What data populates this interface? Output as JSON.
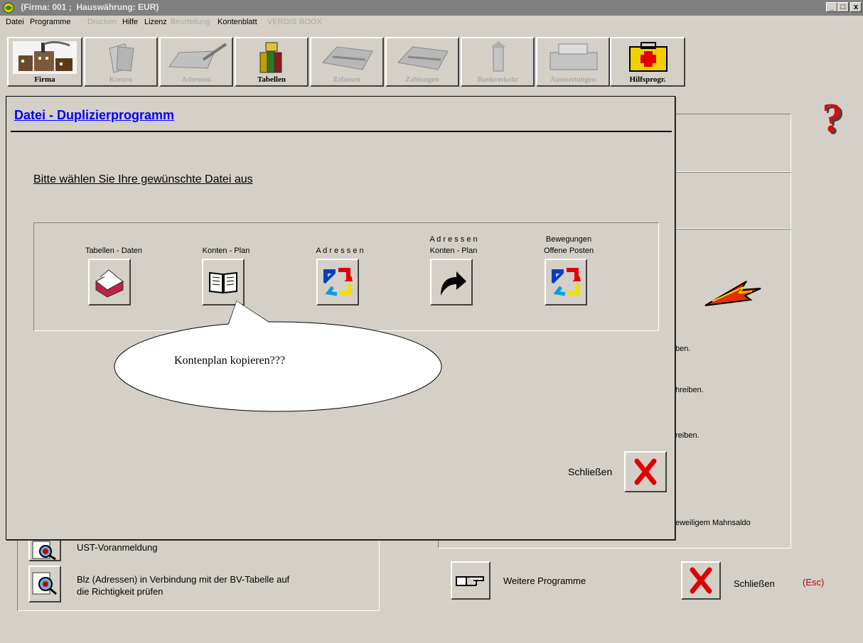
{
  "app": {
    "title": " (Firma: 001 ;  Hauswährung: EUR)",
    "window_buttons": [
      "_",
      "□",
      "x"
    ]
  },
  "menu": [
    {
      "label": "Datei",
      "enabled": true
    },
    {
      "label": "Programme",
      "enabled": true
    },
    {
      "label": "Drucken",
      "enabled": false
    },
    {
      "label": "Hilfe",
      "enabled": true
    },
    {
      "label": "Lizenz",
      "enabled": true
    },
    {
      "label": "Beurteilung",
      "enabled": false
    },
    {
      "label": "Kontenblatt",
      "enabled": true
    },
    {
      "label": "VERDIS",
      "enabled": false
    },
    {
      "label": "BOOX",
      "enabled": false
    }
  ],
  "toolbar": [
    {
      "label": "Firma",
      "enabled": true,
      "icon": "factory-icon"
    },
    {
      "label": "Konten",
      "enabled": false,
      "icon": "papers-icon"
    },
    {
      "label": "Adressen",
      "enabled": false,
      "icon": "pen-icon"
    },
    {
      "label": "Tabellen",
      "enabled": true,
      "icon": "books-icon"
    },
    {
      "label": "Erfassen",
      "enabled": false,
      "icon": "typewriter-icon"
    },
    {
      "label": "Zahlungen",
      "enabled": false,
      "icon": "typewriter-icon"
    },
    {
      "label": "Bankverkehr",
      "enabled": false,
      "icon": "bank-icon"
    },
    {
      "label": "Auswertungen",
      "enabled": false,
      "icon": "printer-icon"
    },
    {
      "label": "Hilfsprogr.",
      "enabled": true,
      "icon": "first-aid-kit-icon"
    }
  ],
  "dialog": {
    "title": "Datei - Duplizierprogramm",
    "prompt": "Bitte wählen Sie Ihre gewünschte Datei aus",
    "options": [
      {
        "label1": "",
        "label2": "Tabellen - Daten",
        "icon": "card-file-icon"
      },
      {
        "label1": "",
        "label2": "Konten  -  Plan",
        "icon": "open-book-icon"
      },
      {
        "label1": "",
        "label2": "A d r e s s e n",
        "icon": "sync-arrows-icon"
      },
      {
        "label1": "A d r e s s e n",
        "label2": "Konten  -  Plan",
        "icon": "curved-arrow-icon"
      },
      {
        "label1": "Bewegungen",
        "label2": "Offene Posten",
        "icon": "sync-arrows-icon"
      }
    ],
    "callout": "Kontenplan kopieren???",
    "close_label": "Schließen"
  },
  "background": {
    "partial_texts": [
      "ben.",
      "hreiben.",
      "reiben.",
      "eweiligem Mahnsaldo"
    ],
    "ust_label": "UST-Voranmeldung",
    "blz_line1": "Blz (Adressen) in Verbindung mit der BV-Tabelle auf",
    "blz_line2": "die Richtigkeit prüfen",
    "more_programs": "Weitere Programme",
    "close_label": "Schließen",
    "close_shortcut": "(Esc)"
  },
  "colors": {
    "link_blue": "#0000ff",
    "esc_red": "#c00000",
    "close_x_red": "#e00000"
  }
}
